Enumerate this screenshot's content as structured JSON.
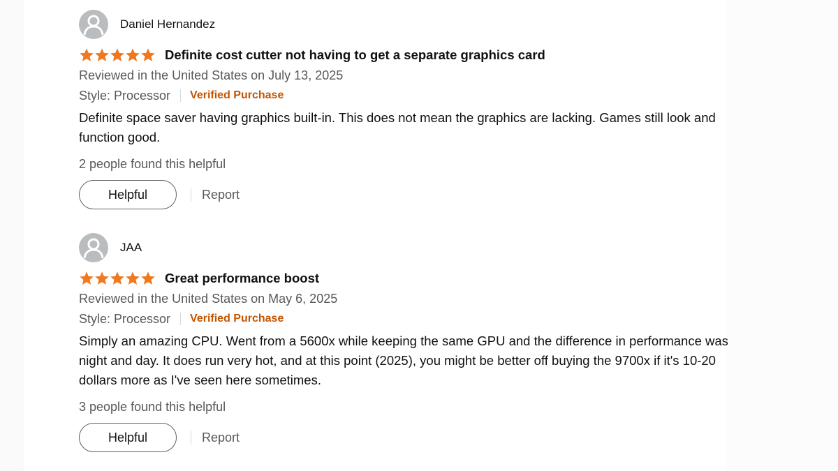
{
  "colors": {
    "star": "#f0781e",
    "verified": "#c45500",
    "muted_text": "#565959",
    "avatar_bg": "#b9bdbf"
  },
  "reviews": [
    {
      "author": "Daniel Hernandez",
      "rating": 5,
      "title": "Definite cost cutter not having to get a separate graphics card",
      "date_line": "Reviewed in the United States on July 13, 2025",
      "style": "Style: Processor",
      "verified": "Verified Purchase",
      "body": "Definite space saver having graphics built-in. This does not mean the graphics are lacking. Games still look and function good.",
      "helpful_count": "2 people found this helpful",
      "helpful_label": "Helpful",
      "report_label": "Report"
    },
    {
      "author": "JAA",
      "rating": 5,
      "title": "Great performance boost",
      "date_line": "Reviewed in the United States on May 6, 2025",
      "style": "Style: Processor",
      "verified": "Verified Purchase",
      "body": "Simply an amazing CPU. Went from a 5600x while keeping the same GPU and the difference in performance was night and day. It does run very hot, and at this point (2025), you might be better off buying the 9700x if it's 10-20 dollars more as I've seen here sometimes.",
      "helpful_count": "3 people found this helpful",
      "helpful_label": "Helpful",
      "report_label": "Report"
    }
  ]
}
